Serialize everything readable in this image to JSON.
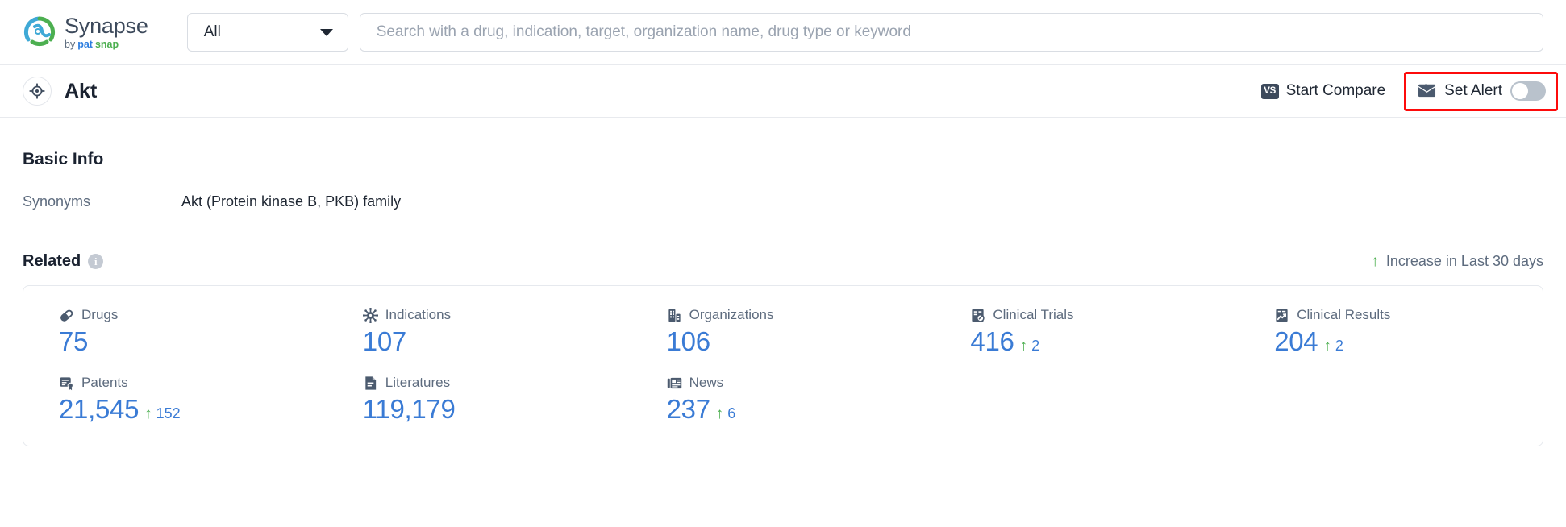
{
  "topbar": {
    "brand_name": "Synapse",
    "brand_by": "by",
    "brand_pat": "pat",
    "brand_snap": "snap",
    "scope_value": "All",
    "search_placeholder": "Search with a drug, indication, target, organization name, drug type or keyword",
    "search_value": ""
  },
  "entity": {
    "title": "Akt",
    "compare_badge": "VS",
    "compare_label": "Start Compare",
    "alert_label": "Set Alert",
    "alert_on": false,
    "highlight_color": "#fd0b0b"
  },
  "basic_info": {
    "heading": "Basic Info",
    "rows": [
      {
        "key": "Synonyms",
        "value": "Akt (Protein kinase B, PKB) family"
      }
    ]
  },
  "related": {
    "heading": "Related",
    "info_glyph": "i",
    "legend_text": "Increase in Last 30 days",
    "legend_arrow": "↑",
    "accent_color": "#3a7bd5",
    "increase_color": "#4caf50",
    "stats": [
      {
        "icon": "pill-icon",
        "label": "Drugs",
        "value": "75",
        "delta": ""
      },
      {
        "icon": "virus-icon",
        "label": "Indications",
        "value": "107",
        "delta": ""
      },
      {
        "icon": "building-icon",
        "label": "Organizations",
        "value": "106",
        "delta": ""
      },
      {
        "icon": "clinical-trial-icon",
        "label": "Clinical Trials",
        "value": "416",
        "delta": "2"
      },
      {
        "icon": "clinical-result-icon",
        "label": "Clinical Results",
        "value": "204",
        "delta": "2"
      },
      {
        "icon": "patent-icon",
        "label": "Patents",
        "value": "21,545",
        "delta": "152"
      },
      {
        "icon": "literature-icon",
        "label": "Literatures",
        "value": "119,179",
        "delta": ""
      },
      {
        "icon": "news-icon",
        "label": "News",
        "value": "237",
        "delta": "6"
      }
    ]
  }
}
